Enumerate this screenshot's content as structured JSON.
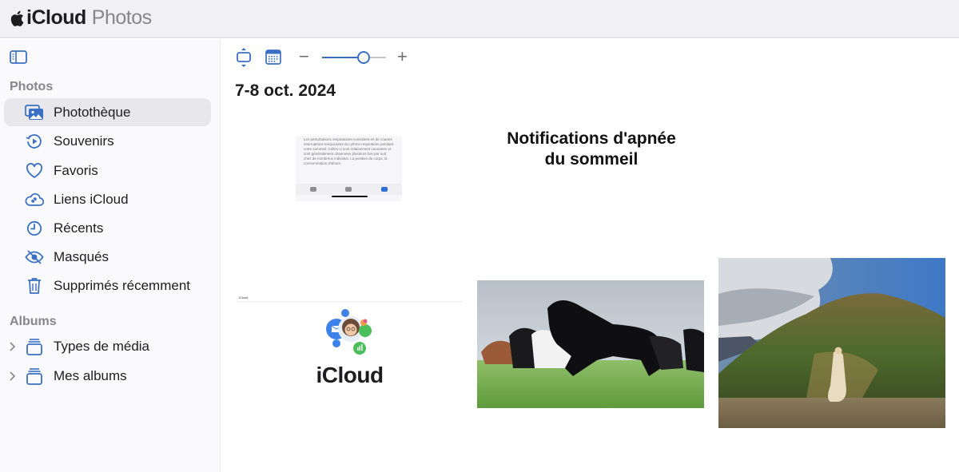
{
  "header": {
    "brand_primary": "iCloud",
    "brand_secondary": "Photos",
    "logo_icon": "apple-logo-icon"
  },
  "sidebar": {
    "toggle_icon": "sidebar-toggle-icon",
    "sections": [
      {
        "title": "Photos",
        "items": [
          {
            "label": "Photothèque",
            "icon": "photo-library-icon",
            "active": true
          },
          {
            "label": "Souvenirs",
            "icon": "memories-icon",
            "active": false
          },
          {
            "label": "Favoris",
            "icon": "heart-icon",
            "active": false
          },
          {
            "label": "Liens iCloud",
            "icon": "icloud-link-icon",
            "active": false
          },
          {
            "label": "Récents",
            "icon": "clock-icon",
            "active": false
          },
          {
            "label": "Masqués",
            "icon": "eye-slash-icon",
            "active": false
          },
          {
            "label": "Supprimés récemment",
            "icon": "trash-icon",
            "active": false
          }
        ]
      },
      {
        "title": "Albums",
        "items": [
          {
            "label": "Types de média",
            "icon": "album-stack-icon",
            "expandable": true
          },
          {
            "label": "Mes albums",
            "icon": "album-stack-icon",
            "expandable": true
          }
        ]
      }
    ]
  },
  "toolbar": {
    "aspect_toggle_icon": "aspect-ratio-icon",
    "calendar_icon": "calendar-grid-icon",
    "zoom_out_label": "−",
    "zoom_in_label": "+",
    "zoom_level_fraction": 0.65
  },
  "main": {
    "date_heading": "7-8 oct. 2024",
    "photos": [
      {
        "kind": "screenshot",
        "description": "Texte sur les perturbations respiratoires",
        "text": "Les perturbations respiratoires consistent en de courtes interruptions temporaires du rythme respiratoire pendant votre sommeil. Celles-ci sont relativement courantes et sont généralement observées plusieurs fois par nuit chez de nombreux individus. La position du corps, la consommation d'alcool,"
      },
      {
        "kind": "screenshot",
        "line1": "Notifications d'apnée",
        "line2": "du sommeil"
      },
      {
        "kind": "screenshot",
        "header": "iCloud",
        "word": "iCloud"
      },
      {
        "kind": "photo",
        "description": "Chevaux galopant dans un pré"
      },
      {
        "kind": "photo",
        "description": "Femme en robe blanche devant une montagne"
      }
    ]
  },
  "colors": {
    "accent": "#3a6fc4",
    "header_bg": "#f1f1f5",
    "sidebar_bg": "#fafafd",
    "active_item_bg": "#e8e8ec",
    "section_title": "#86868b"
  }
}
